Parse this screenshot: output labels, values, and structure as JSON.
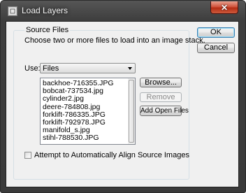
{
  "window": {
    "title": "Load Layers",
    "close_glyph": "✕"
  },
  "source_files": {
    "legend": "Source Files",
    "instruction": "Choose two or more files to load into an image stack.",
    "use_label": "Use:",
    "use_value": "Files",
    "files": [
      "backhoe-716355.JPG",
      "bobcat-737534.jpg",
      "cylinder2.jpg",
      "deere-784808.jpg",
      "forklift-786335.JPG",
      "forklift-792978.JPG",
      "manifold_s.jpg",
      "stihl-788530.JPG"
    ],
    "browse_label": "Browse...",
    "remove_label": "Remove",
    "add_open_files_label": "Add Open Files"
  },
  "ok_label": "OK",
  "cancel_label": "Cancel",
  "align_checkbox": {
    "label": "Attempt to Automatically Align Source Images",
    "checked": false
  }
}
